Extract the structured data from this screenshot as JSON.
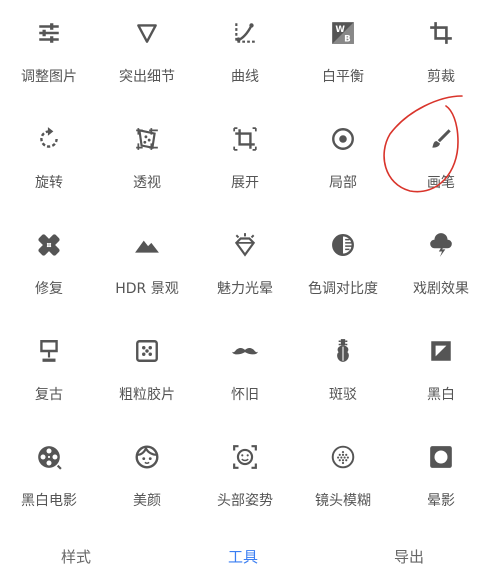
{
  "tools": [
    {
      "label": "调整图片",
      "icon": "sliders-icon"
    },
    {
      "label": "突出细节",
      "icon": "triangle-down-icon"
    },
    {
      "label": "曲线",
      "icon": "curve-icon"
    },
    {
      "label": "白平衡",
      "icon": "white-balance-icon"
    },
    {
      "label": "剪裁",
      "icon": "crop-icon"
    },
    {
      "label": "旋转",
      "icon": "rotate-icon"
    },
    {
      "label": "透视",
      "icon": "perspective-icon"
    },
    {
      "label": "展开",
      "icon": "expand-icon"
    },
    {
      "label": "局部",
      "icon": "target-icon"
    },
    {
      "label": "画笔",
      "icon": "brush-icon"
    },
    {
      "label": "修复",
      "icon": "bandage-icon"
    },
    {
      "label": "HDR 景观",
      "icon": "mountain-icon"
    },
    {
      "label": "魅力光晕",
      "icon": "diamond-glow-icon"
    },
    {
      "label": "色调对比度",
      "icon": "tonal-contrast-icon"
    },
    {
      "label": "戏剧效果",
      "icon": "cloud-lightning-icon"
    },
    {
      "label": "复古",
      "icon": "lamp-icon"
    },
    {
      "label": "粗粒胶片",
      "icon": "dice-icon"
    },
    {
      "label": "怀旧",
      "icon": "mustache-icon"
    },
    {
      "label": "斑驳",
      "icon": "guitar-icon"
    },
    {
      "label": "黑白",
      "icon": "black-white-icon"
    },
    {
      "label": "黑白电影",
      "icon": "film-reel-icon"
    },
    {
      "label": "美颜",
      "icon": "face-icon"
    },
    {
      "label": "头部姿势",
      "icon": "head-pose-icon"
    },
    {
      "label": "镜头模糊",
      "icon": "lens-blur-icon"
    },
    {
      "label": "晕影",
      "icon": "vignette-icon"
    }
  ],
  "tabs": [
    {
      "label": "样式",
      "active": false
    },
    {
      "label": "工具",
      "active": true
    },
    {
      "label": "导出",
      "active": false
    }
  ],
  "colors": {
    "icon": "#555555",
    "active_tab": "#3a7ef2",
    "annotation": "#d9342b"
  }
}
